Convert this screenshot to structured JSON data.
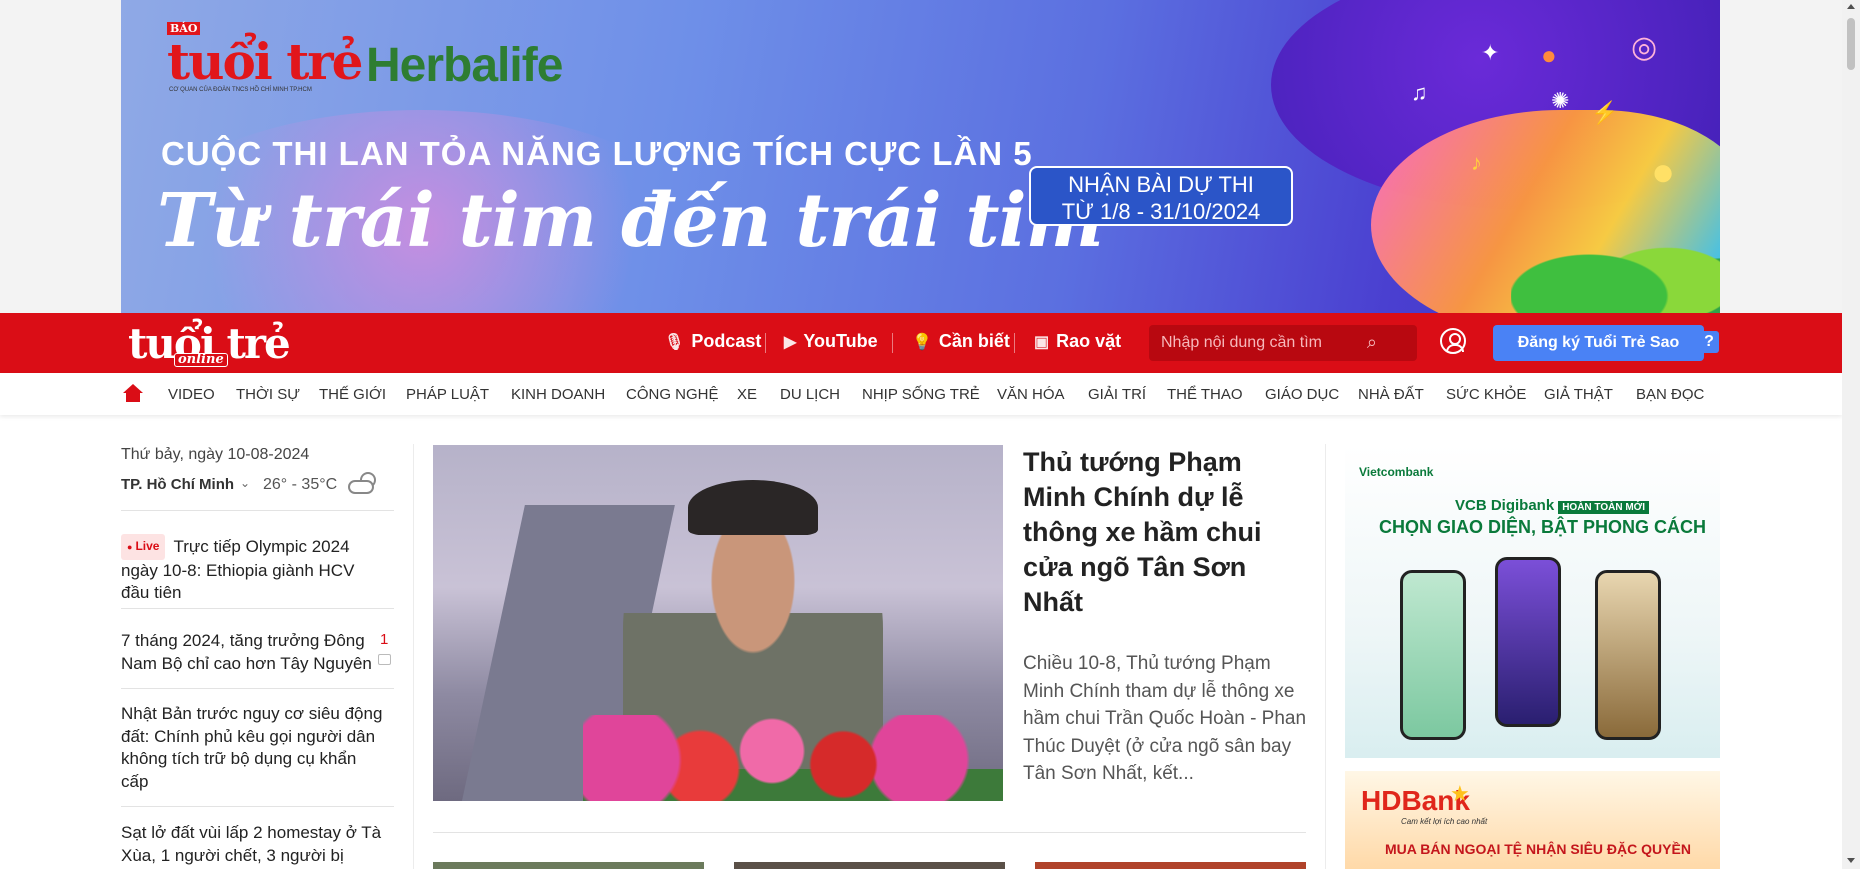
{
  "banner": {
    "paper_label": "BÁO",
    "paper_logo": "tuổi trẻ",
    "paper_subline": "CƠ QUAN CỦA ĐOÀN TNCS HỒ CHÍ MINH TP.HCM",
    "sponsor": "Herbalife",
    "contest_title": "CUỘC THI LAN TỎA NĂNG LƯỢNG TÍCH CỰC LẦN 5",
    "contest_slogan": "Từ trái tim đến trái tim",
    "deadline_line1": "NHẬN BÀI DỰ THI",
    "deadline_line2": "TỪ 1/8 - 31/10/2024"
  },
  "header": {
    "logo": "tuổi trẻ",
    "logo_online": "online",
    "links": {
      "podcast": "Podcast",
      "youtube": "YouTube",
      "can_biet": "Cần biết",
      "rao_vat": "Rao vặt"
    },
    "search_placeholder": "Nhập nội dung cần tìm",
    "register_button": "Đăng ký Tuổi Trẻ Sao",
    "help": "?"
  },
  "categories": [
    "VIDEO",
    "THỜI SỰ",
    "THẾ GIỚI",
    "PHÁP LUẬT",
    "KINH DOANH",
    "CÔNG NGHỆ",
    "XE",
    "DU LỊCH",
    "NHỊP SỐNG TRẺ",
    "VĂN HÓA",
    "GIẢI TRÍ",
    "THỂ THAO",
    "GIÁO DỤC",
    "NHÀ ĐẤT",
    "SỨC KHỎE",
    "GIẢ THẬT",
    "BẠN ĐỌC"
  ],
  "sidebar": {
    "date": "Thứ bảy, ngày 10-08-2024",
    "city": "TP. Hồ Chí Minh",
    "temperature": "26° - 35°C",
    "live_badge": "Live",
    "news": [
      "Trực tiếp Olympic 2024 ngày 10-8: Ethiopia giành HCV đầu tiên",
      "7 tháng 2024, tăng trưởng Đông Nam Bộ chỉ cao hơn Tây Nguyên",
      "Nhật Bản trước nguy cơ siêu động đất: Chính phủ kêu gọi người dân không tích trữ bộ dụng cụ khẩn cấp",
      "Sạt lở đất vùi lấp 2 homestay ở Tà Xùa, 1 người chết, 3 người bị"
    ],
    "comment_count": "1"
  },
  "main_story": {
    "title": "Thủ tướng Phạm Minh Chính dự lễ thông xe hầm chui cửa ngõ Tân Sơn Nhất",
    "sapo": "Chiều 10-8, Thủ tướng Phạm Minh Chính tham dự lễ thông xe hầm chui Trần Quốc Hoàn - Phan Thúc Duyệt (ở cửa ngõ sân bay Tân Sơn Nhất, kết..."
  },
  "ads": {
    "vcb_brand": "Vietcombank",
    "vcb_product": "VCB Digibank",
    "vcb_badge": "HOÀN TOÀN MỚI",
    "vcb_slogan": "CHỌN GIAO DIỆN, BẬT PHONG CÁCH",
    "hd_brand": "HDBank",
    "hd_tagline": "Cam kết lợi ích cao nhất",
    "hd_offer": "MUA BÁN NGOẠI TỆ NHẬN SIÊU ĐẶC QUYỀN"
  },
  "colors": {
    "brand_red": "#da0d16",
    "register_blue": "#4a82f5"
  }
}
